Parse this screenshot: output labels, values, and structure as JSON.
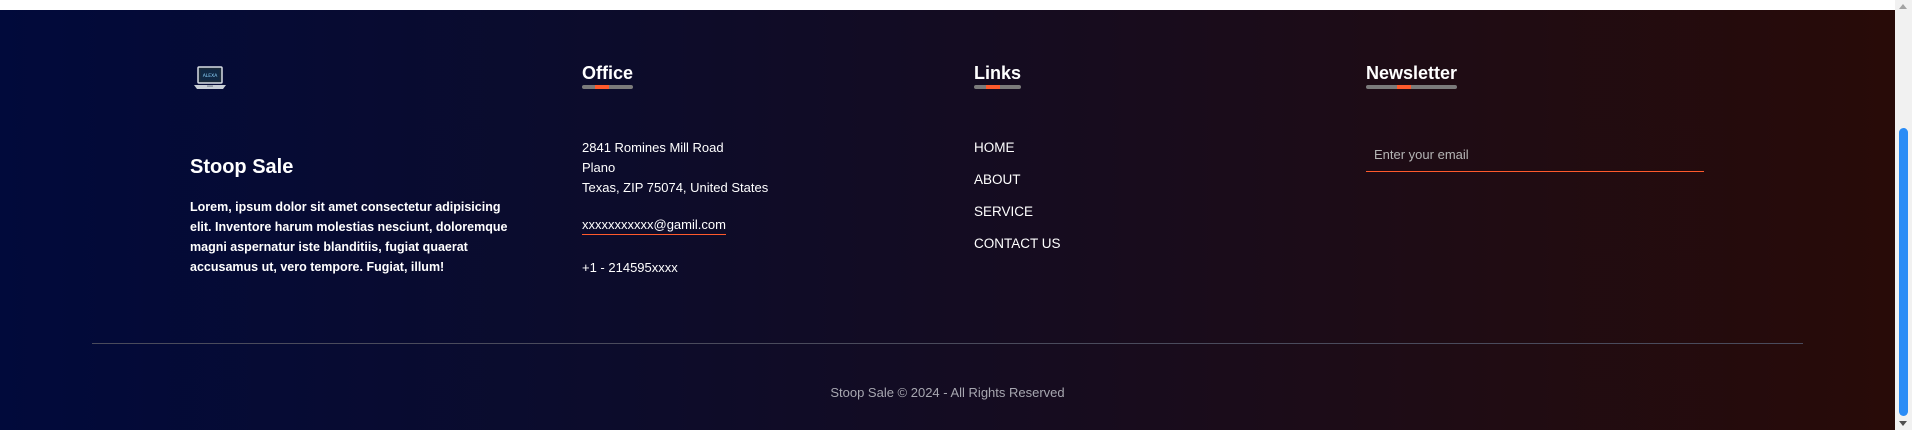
{
  "brand": {
    "logo_text": "ALEXA",
    "title": "Stoop Sale",
    "description": "Lorem, ipsum dolor sit amet consectetur adipisicing elit. Inventore harum molestias nesciunt, doloremque magni aspernatur iste blanditiis, fugiat quaerat accusamus ut, vero tempore. Fugiat, illum!"
  },
  "office": {
    "title": "Office",
    "address_line1": "2841 Romines Mill Road",
    "address_line2": "Plano",
    "address_line3": "Texas, ZIP 75074, United States",
    "email": "xxxxxxxxxxx@gamil.com",
    "phone": "+1 - 214595xxxx"
  },
  "links": {
    "title": "Links",
    "items": [
      {
        "label": "HOME"
      },
      {
        "label": "ABOUT"
      },
      {
        "label": "SERVICE"
      },
      {
        "label": "CONTACT US"
      }
    ]
  },
  "newsletter": {
    "title": "Newsletter",
    "email_placeholder": "Enter your email",
    "email_value": ""
  },
  "copyright": "Stoop Sale © 2024 - All Rights Reserved",
  "colors": {
    "accent": "#ff5a2c",
    "gradient_start": "#010a3b",
    "gradient_end": "#280b08",
    "scrollbar_thumb": "#2a8cf6"
  },
  "icons": {
    "logo": "laptop-icon"
  }
}
